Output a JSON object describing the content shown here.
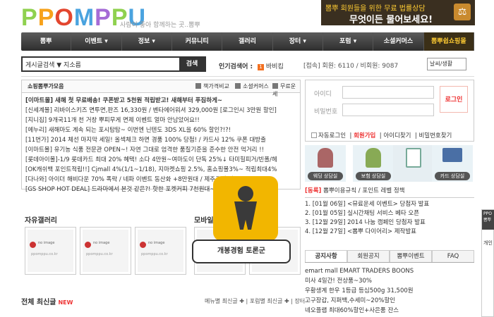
{
  "header": {
    "logo_text": "PPOMPPU",
    "tagline": "사람이 좋아 함께하는 곳..뽐뿌",
    "banner": {
      "line1_a": "뽐뿌 회원들을 위한",
      "line1_b": "무료 법률상담",
      "line2": "무엇이든 물어보세요!"
    }
  },
  "nav": {
    "items": [
      "뽐뿌",
      "이벤트 ▾",
      "정보 ▾",
      "커뮤니티",
      "갤러리",
      "장터 ▾",
      "포럼 ▾",
      "소셜커머스",
      "뽐뿌쉽쇼핑몰"
    ]
  },
  "search": {
    "scope": "게시글검색 ▼ 지소름",
    "placeholder": "",
    "button": "검색"
  },
  "popular": {
    "label": "인기검색어 :",
    "rank": "1",
    "keyword": "바비킴"
  },
  "stats": {
    "text": "[접속] 회원: 6110 / 비회원: 9087"
  },
  "weather": {
    "label": "날씨/생활"
  },
  "shopping": {
    "tab_main": "쇼핑뽐뿌가모음",
    "tab2": "책가격비교",
    "tab3": "소셜커머스",
    "tab4": "무료운세",
    "items": [
      "[이마트몰] 새해 첫 무료배송! 쿠폰받고 5천원 적립받고! 새해부터 푸짐하게~",
      "[신세계몰] 리바이스키즈 면투면,판즈 16,330원 / 벤타에어워셔 329,000원 [로그인시 3만원 할인]",
      "[지니집] 9개국11개 천 거창 뿌피무게 면제 이벤트 얼마 안남았어요!!",
      "[에누리] 새해마도 계속 되는 포시탐탐~ 이번엔 닌텐도 3DS XL을 60% 할인?!?!",
      "[11번가] 2014 체선 마지막 세일! 올섹체크 하면 경품 100% 당첨! / 카드사 12% 쿠폰 대방출",
      "[이마트몰] 유기농 식품 전문관 OPEN~! 자연 그대로 엄격한 품질기준을 준수한 안전 먹거리 !!",
      "[롯데아이몰]-1/9 롯데카드 최대 20% 혜택! 소다 4만원~여마도이 단독 25%↓ 타미힐피거/빈폴/헤",
      "[OK캐쉬백 포인트적립!!] Cjmall 4%(1/1~1/18), 지마켓쇼핑 2.5%, 홈쇼핑몰3%~ 적립최대4%",
      "[다나와] 아이더 해비다운 70% 폭락 / 네파 이벤트 동산화 +8만원대 / 제주크레 파트스",
      "[GS SHOP HOT DEAL] 드라마에서 본것 같은?! 핫한 포켓커피 7천원대~ 초극세사"
    ]
  },
  "galleries": {
    "free": "자유갤러리",
    "mobile": "모바일갤러리",
    "thumb_caption": "ppomppu.co.kr",
    "thumb_note": "no image"
  },
  "all_posts": {
    "title": "전체 최신글",
    "badge": "NEW",
    "links": "메뉴별 최신글 ✚ | 포럼별 최신글 ✚ | 장터"
  },
  "login": {
    "id_label": "아이디",
    "pw_label": "비밀번호",
    "button": "로그인",
    "auto_login": "자동로그인",
    "join": "회원가입",
    "find_id": "아이디찾기",
    "find_pw": "비밀번호찾기"
  },
  "consult": [
    "웨딩 상담실",
    "보험 상담실",
    "",
    "카드 상담실"
  ],
  "notice": {
    "head_tag": "[동록]",
    "head_text": "뽐뿌이용규칙 / 포인트 레벨 정책",
    "items": [
      "1. [01월 06일] <뮤료운세 이벤트> 당첨자 발표",
      "2. [01월 05일] 실시간채팅 서비스 베타 오픈",
      "3. [12월 29일] 2014 나눔 캠페인 당첨자 발표",
      "4. [12월 27일] <뽐뿌 다이어리> 제작발표"
    ]
  },
  "notice_tabs": [
    "공지사항",
    "회원공지",
    "뽐뿌이벤트",
    "FAQ"
  ],
  "notice_list": [
    "emart mall EMART TRADERS BOONS",
    "미사 4일간! 전상품~30%",
    "우황생계 한우 1등급 등심500g 31,500원",
    "고구장갑, 지퍼백,수세미~20%할인",
    "네오플랩 최대60%할인+사은품 잔스"
  ],
  "overlay": {
    "sticker_text": "개봉경험 토론군"
  },
  "sidebox": {
    "head": "PPO 뽐뿌",
    "body": "개인"
  }
}
